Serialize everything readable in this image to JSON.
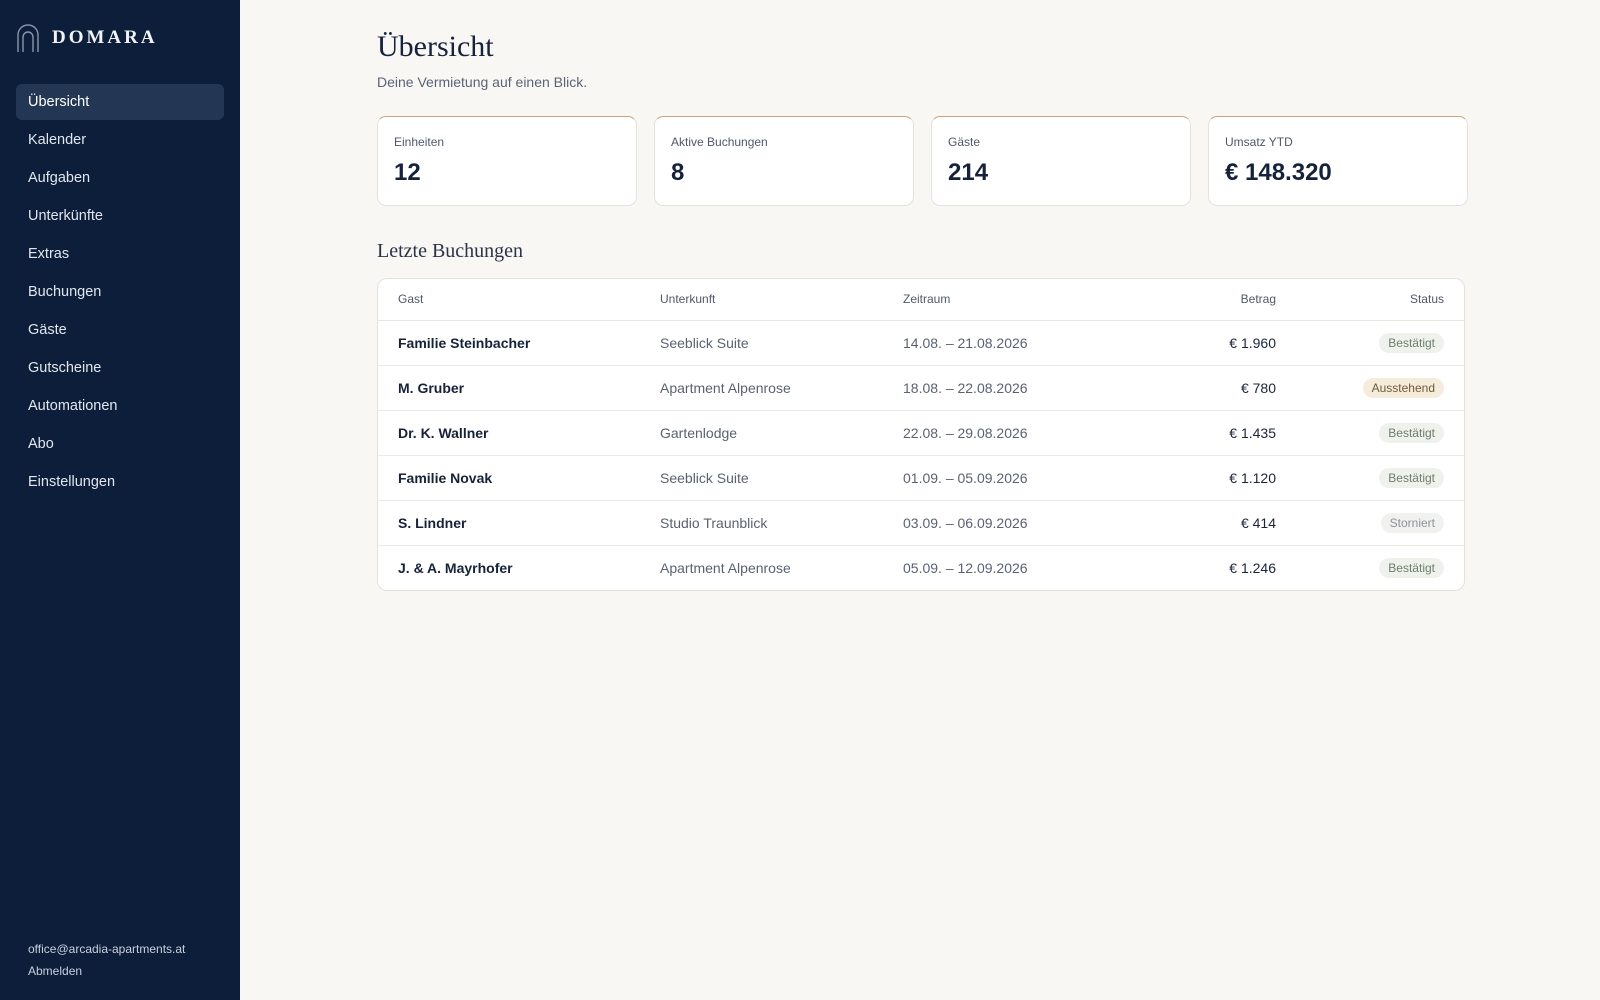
{
  "brand": {
    "name": "DOMARA"
  },
  "nav": {
    "items": [
      {
        "label": "Übersicht",
        "active": true
      },
      {
        "label": "Kalender"
      },
      {
        "label": "Aufgaben"
      },
      {
        "label": "Unterkünfte"
      },
      {
        "label": "Extras"
      },
      {
        "label": "Buchungen"
      },
      {
        "label": "Gäste"
      },
      {
        "label": "Gutscheine"
      },
      {
        "label": "Automationen"
      },
      {
        "label": "Abo"
      },
      {
        "label": "Einstellungen"
      }
    ]
  },
  "account": {
    "email": "office@arcadia-apartments.at",
    "logout_label": "Abmelden"
  },
  "header": {
    "title": "Übersicht",
    "subtitle": "Deine Vermietung auf einen Blick."
  },
  "stats": [
    {
      "label": "Einheiten",
      "value": "12"
    },
    {
      "label": "Aktive Buchungen",
      "value": "8"
    },
    {
      "label": "Gäste",
      "value": "214"
    },
    {
      "label": "Umsatz YTD",
      "value": "€ 148.320"
    }
  ],
  "bookings": {
    "title": "Letzte Buchungen",
    "columns": {
      "guest": "Gast",
      "unit": "Unterkunft",
      "period": "Zeitraum",
      "amount": "Betrag",
      "status": "Status"
    },
    "rows": [
      {
        "guest": "Familie Steinbacher",
        "unit": "Seeblick Suite",
        "period": "14.08. – 21.08.2026",
        "amount": "€ 1.960",
        "status": "Bestätigt",
        "status_type": "confirmed"
      },
      {
        "guest": "M. Gruber",
        "unit": "Apartment Alpenrose",
        "period": "18.08. – 22.08.2026",
        "amount": "€ 780",
        "status": "Ausstehend",
        "status_type": "pending"
      },
      {
        "guest": "Dr. K. Wallner",
        "unit": "Gartenlodge",
        "period": "22.08. – 29.08.2026",
        "amount": "€ 1.435",
        "status": "Bestätigt",
        "status_type": "confirmed"
      },
      {
        "guest": "Familie Novak",
        "unit": "Seeblick Suite",
        "period": "01.09. – 05.09.2026",
        "amount": "€ 1.120",
        "status": "Bestätigt",
        "status_type": "confirmed"
      },
      {
        "guest": "S. Lindner",
        "unit": "Studio Traunblick",
        "period": "03.09. – 06.09.2026",
        "amount": "€ 414",
        "status": "Storniert",
        "status_type": "cancelled"
      },
      {
        "guest": "J. & A. Mayrhofer",
        "unit": "Apartment Alpenrose",
        "period": "05.09. – 12.09.2026",
        "amount": "€ 1.246",
        "status": "Bestätigt",
        "status_type": "confirmed"
      }
    ]
  },
  "colors": {
    "sidebar_bg": "#0c1e3a",
    "accent": "#c9a67a",
    "page_bg": "#f8f7f4"
  }
}
